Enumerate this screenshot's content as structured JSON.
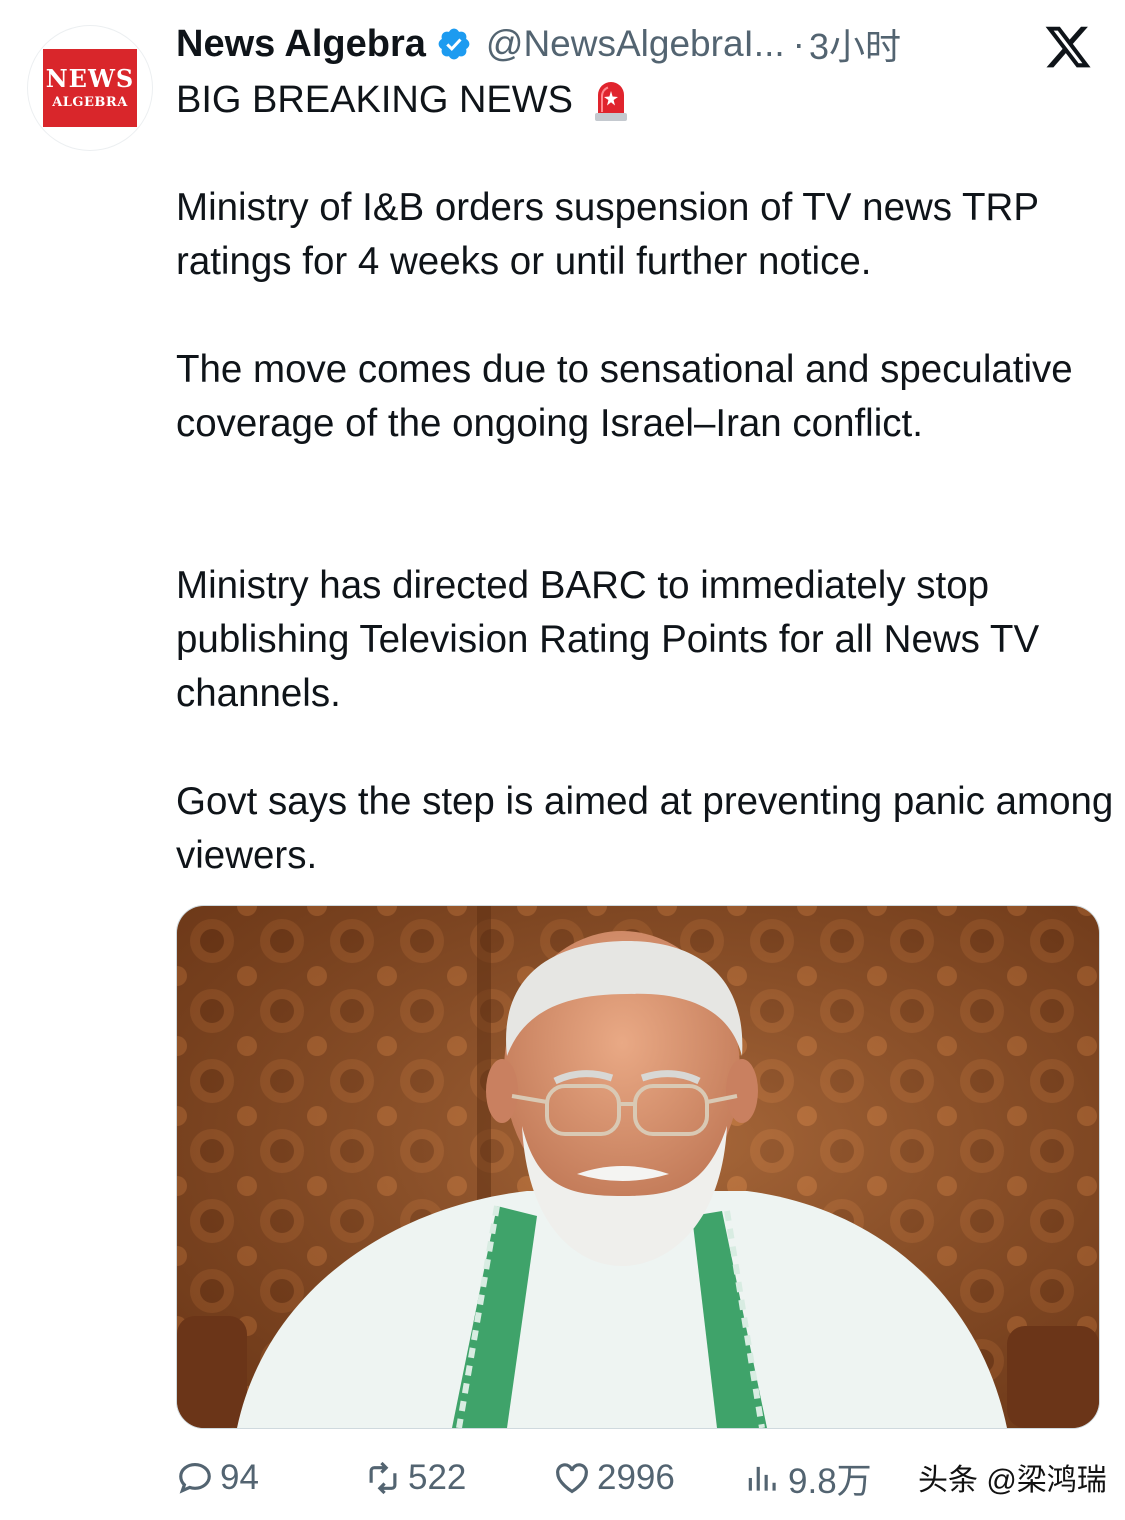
{
  "tweet": {
    "author": {
      "display_name": "News Algebra",
      "handle": "@NewsAlgebraI...",
      "verified": true,
      "avatar_logo_line1": "NEWS",
      "avatar_logo_line2": "ALGEBRA"
    },
    "separator": "·",
    "timestamp": "3小时",
    "headline": "BIG BREAKING NEWS",
    "headline_emoji": "siren-icon",
    "paragraphs": [
      "Ministry of I&B orders suspension of TV news TRP ratings for 4 weeks or until further notice.",
      "The move comes due to sensational and speculative coverage of the ongoing Israel–Iran conflict.",
      "Ministry has directed BARC to immediately stop publishing Television Rating Points for all News TV channels.",
      "Govt says the step is aimed at preventing panic among viewers."
    ],
    "media": {
      "type": "photo",
      "description_icon": "photo-of-man-in-white-kurta"
    },
    "stats": {
      "replies": "94",
      "reposts": "522",
      "likes": "2996",
      "views": "9.8万"
    }
  },
  "watermark": "头条 @梁鸿瑞",
  "colors": {
    "text_primary": "#0f1419",
    "text_secondary": "#536471",
    "verified_blue": "#1d9bf0",
    "logo_red": "#d9262b"
  }
}
